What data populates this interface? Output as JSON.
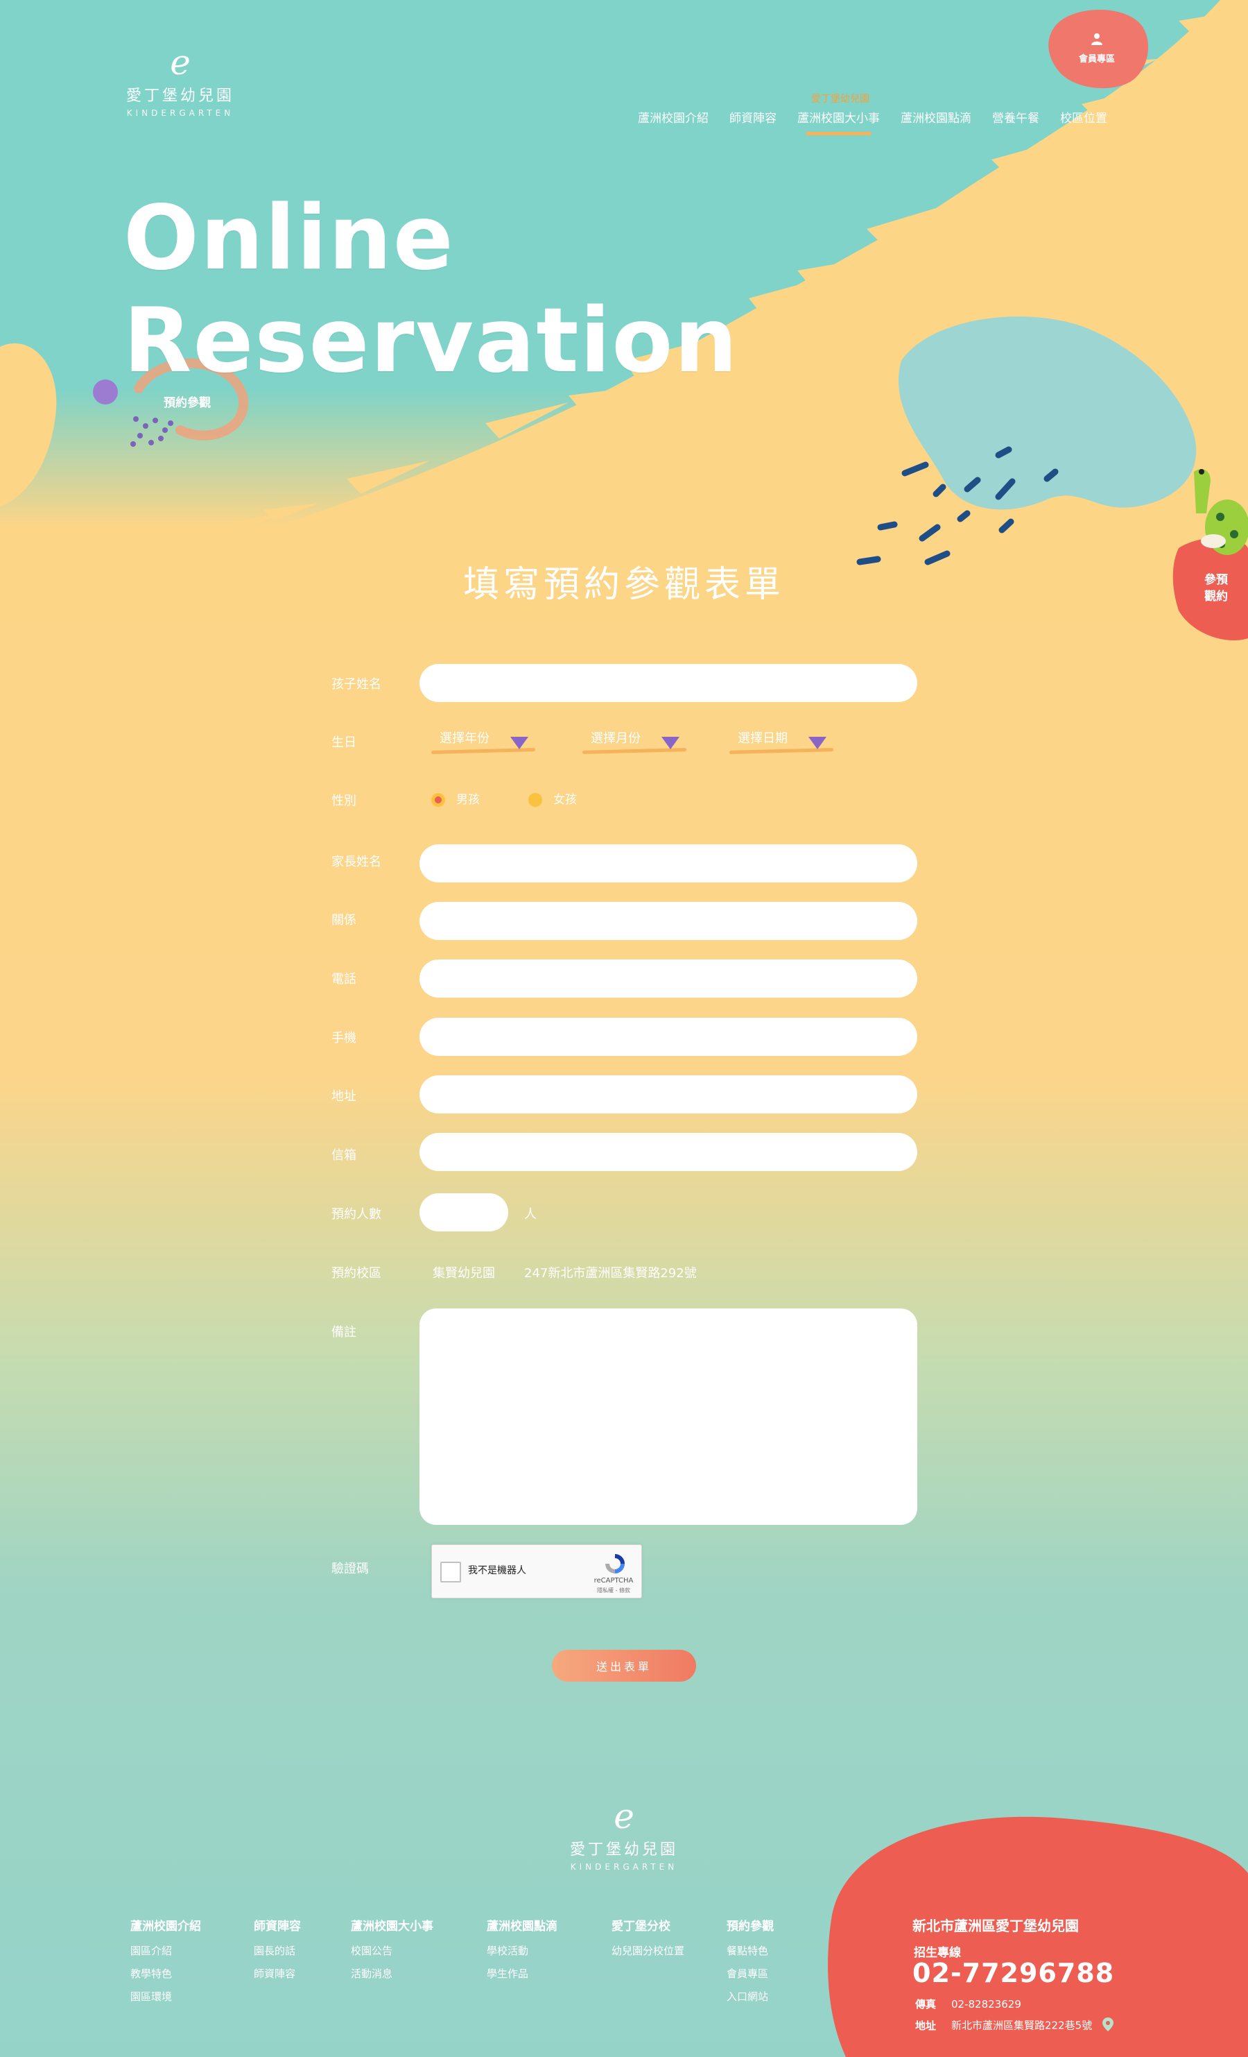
{
  "header": {
    "logo_mark": "e",
    "logo_name": "愛丁堡幼兒園",
    "logo_sub": "KINDERGARTEN",
    "member_label": "會員專區",
    "member_icon": "user-icon",
    "nav_tip": "愛丁堡幼兒園",
    "nav": [
      "蘆洲校園介紹",
      "師資陣容",
      "蘆洲校園大小事",
      "蘆洲校園點滴",
      "營養午餐",
      "校區位置"
    ],
    "active_nav": "蘆洲校園大小事"
  },
  "hero": {
    "title_line1": "Online",
    "title_line2": "Reservation",
    "badge": "預約參觀"
  },
  "side_button": {
    "line1": "參預",
    "line2": "觀約"
  },
  "form": {
    "title": "填寫預約參觀表單",
    "labels": {
      "child_name": "孩子姓名",
      "birthday": "生日",
      "gender": "性別",
      "parent_name": "家長姓名",
      "relation": "關係",
      "phone": "電話",
      "mobile": "手機",
      "address": "地址",
      "email": "信箱",
      "count": "預約人數",
      "campus": "預約校區",
      "notes": "備註",
      "captcha": "驗證碼"
    },
    "birthday_selects": [
      "選擇年份",
      "選擇月份",
      "選擇日期"
    ],
    "gender_options": [
      "男孩",
      "女孩"
    ],
    "gender_selected": "男孩",
    "count_unit": "人",
    "campus_name": "集賢幼兒園",
    "campus_address": "247新北市蘆洲區集賢路292號",
    "captcha_label": "我不是機器人",
    "captcha_brand": "reCAPTCHA",
    "captcha_terms": "隱私權 - 條款",
    "submit": "送出表單"
  },
  "footer": {
    "logo_mark": "e",
    "logo_name": "愛丁堡幼兒園",
    "logo_sub": "KINDERGARTEN",
    "columns": [
      {
        "head": "蘆洲校園介紹",
        "items": [
          "園區介紹",
          "教學特色",
          "園區環境"
        ]
      },
      {
        "head": "師資陣容",
        "items": [
          "園長的話",
          "師資陣容"
        ]
      },
      {
        "head": "蘆洲校園大小事",
        "items": [
          "校園公告",
          "活動消息"
        ]
      },
      {
        "head": "蘆洲校園點滴",
        "items": [
          "學校活動",
          "學生作品"
        ]
      },
      {
        "head": "愛丁堡分校",
        "items": [
          "幼兒園分校位置"
        ]
      },
      {
        "head": "預約參觀",
        "items": [
          "餐點特色",
          "會員專區",
          "入口網站"
        ]
      }
    ],
    "contact_title": "新北市蘆洲區愛丁堡幼兒園",
    "hotline_label": "招生專線",
    "phone": "02-77296788",
    "fax_label": "傳真",
    "fax": "02-82823629",
    "address_label": "地址",
    "address": "新北市蘆洲區集賢路222巷5號",
    "pin_icon": "location-pin-icon"
  },
  "colors": {
    "teal": "#7fd3c8",
    "sand": "#fcd587",
    "coral": "#ee5d52",
    "orange_accent": "#f6b25a",
    "purple_arrow": "#8a65c8",
    "navy_dash": "#1f4e86"
  }
}
